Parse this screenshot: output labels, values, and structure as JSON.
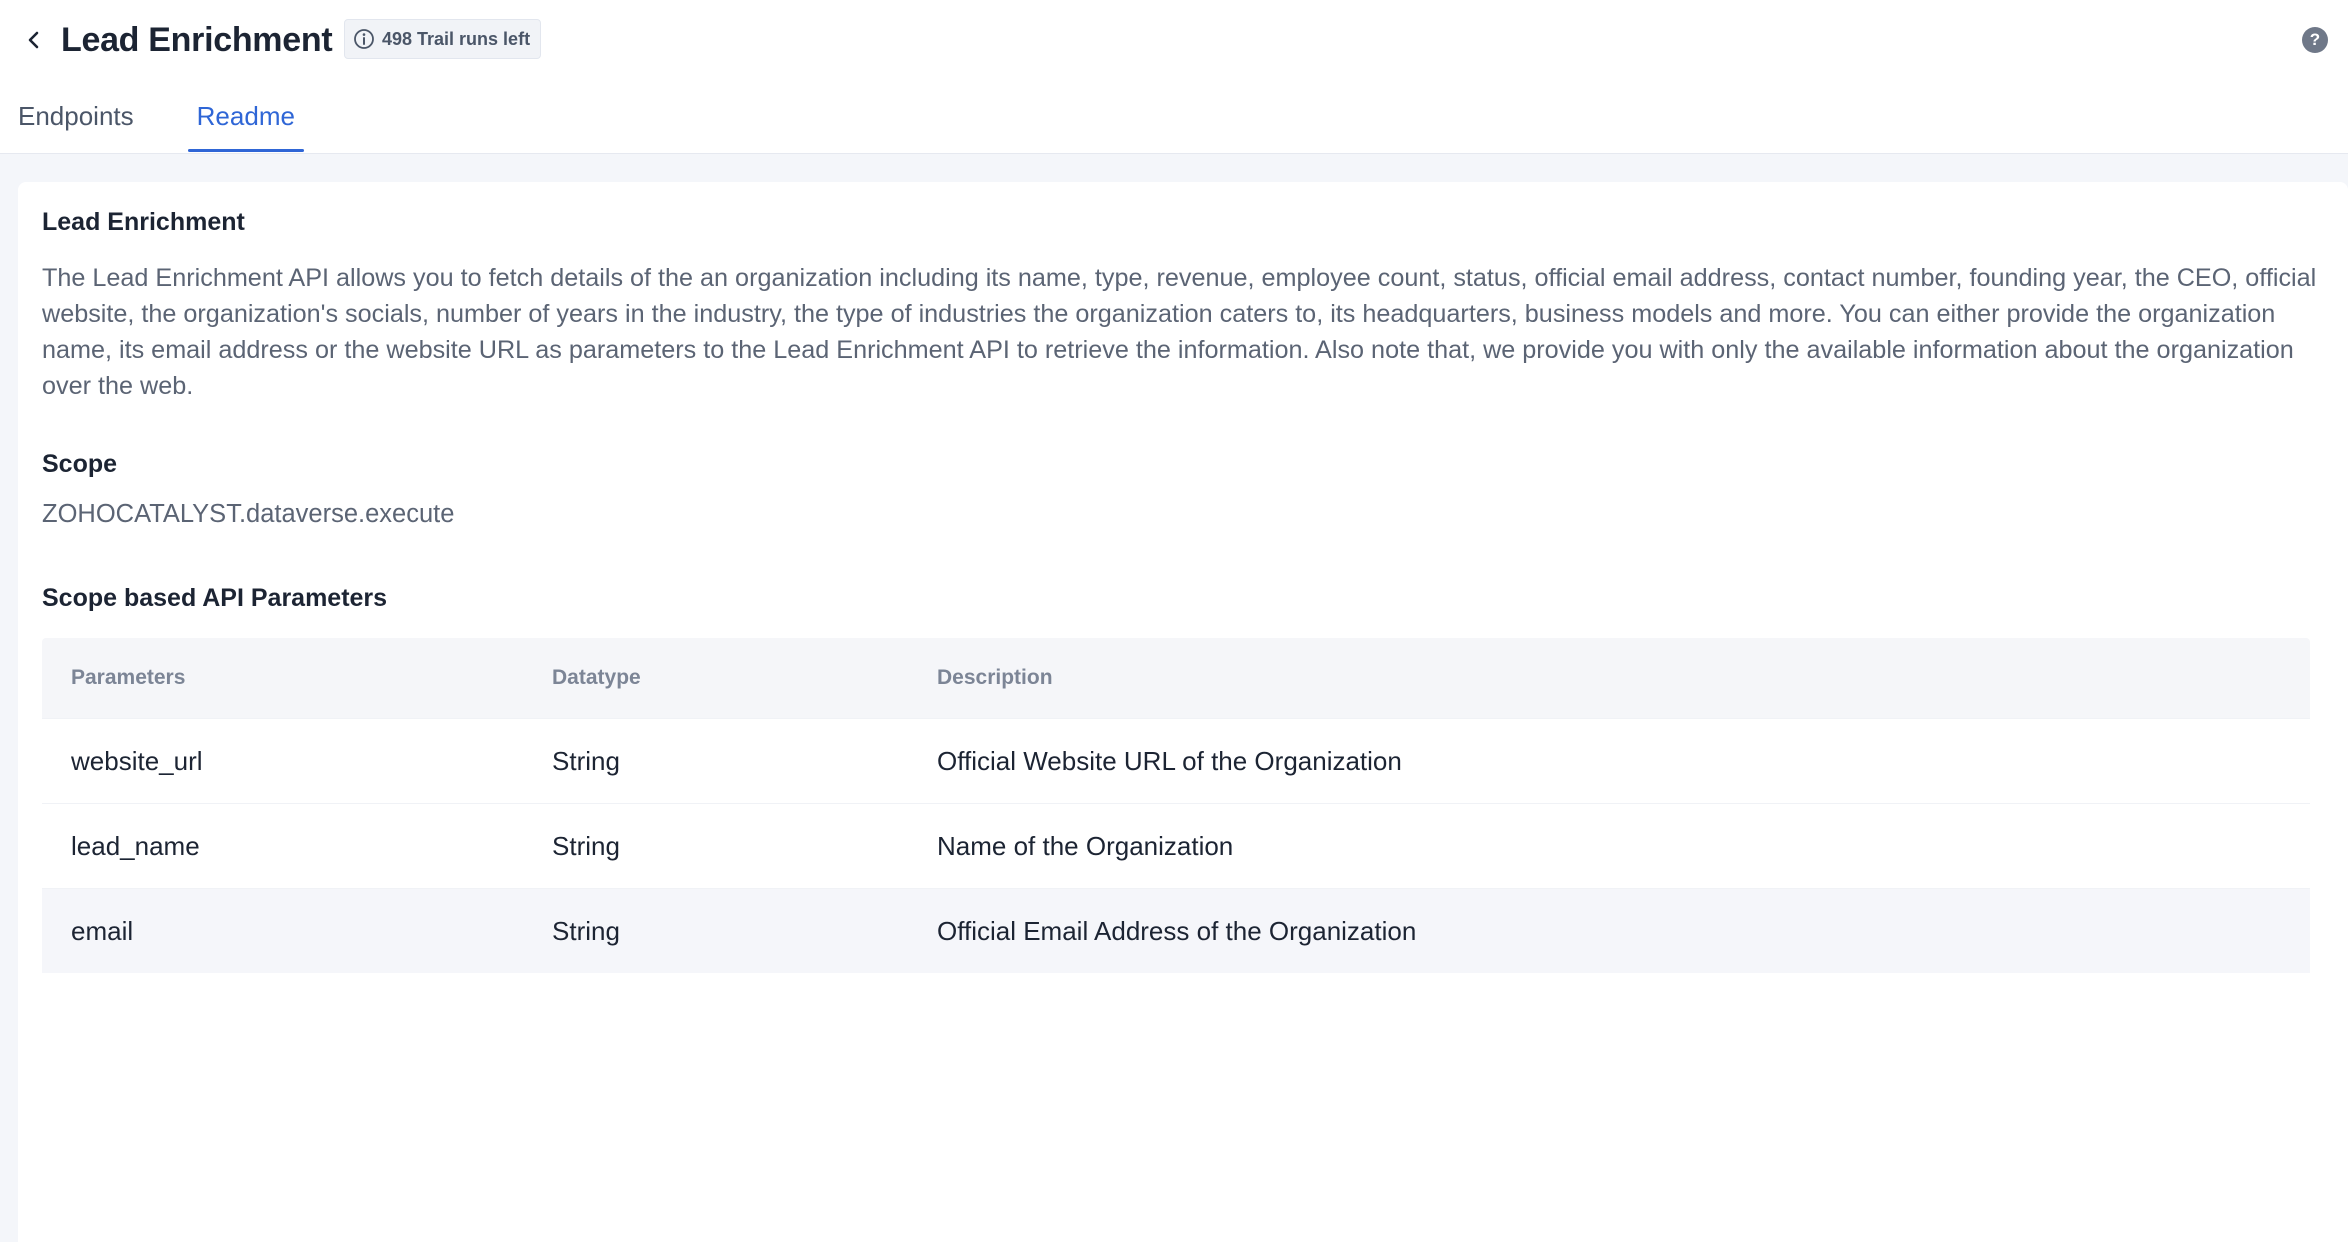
{
  "header": {
    "title": "Lead Enrichment",
    "trial_badge": "498 Trail runs left",
    "help_symbol": "?",
    "icons": {
      "back": "chevron-left-icon",
      "info": "info-circle-icon",
      "help": "help-circle-icon"
    }
  },
  "tabs": [
    {
      "label": "Endpoints",
      "active": false
    },
    {
      "label": "Readme",
      "active": true
    }
  ],
  "readme": {
    "title": "Lead Enrichment",
    "description": "The Lead Enrichment API allows you to fetch details of the an organization including its name, type, revenue, employee count, status, official email address, contact number, founding year, the CEO, official website, the organization's socials, number of years in the industry, the type of industries the organization caters to, its headquarters, business models and more. You can either provide the organization name, its email address or the website URL as parameters to the Lead Enrichment API to retrieve the information. Also note that, we provide you with only the available information about the organization over the web.",
    "scope_title": "Scope",
    "scope_value": "ZOHOCATALYST.dataverse.execute",
    "params_title": "Scope based API Parameters",
    "table": {
      "columns": [
        "Parameters",
        "Datatype",
        "Description"
      ],
      "rows": [
        [
          "website_url",
          "String",
          "Official Website URL of the Organization"
        ],
        [
          "lead_name",
          "String",
          "Name of the Organization"
        ],
        [
          "email",
          "String",
          "Official Email Address of the Organization"
        ]
      ]
    }
  },
  "colors": {
    "accent": "#2f66d6",
    "text_primary": "#1c2433",
    "text_muted": "#5b6474",
    "page_bg": "#f4f6fa"
  }
}
